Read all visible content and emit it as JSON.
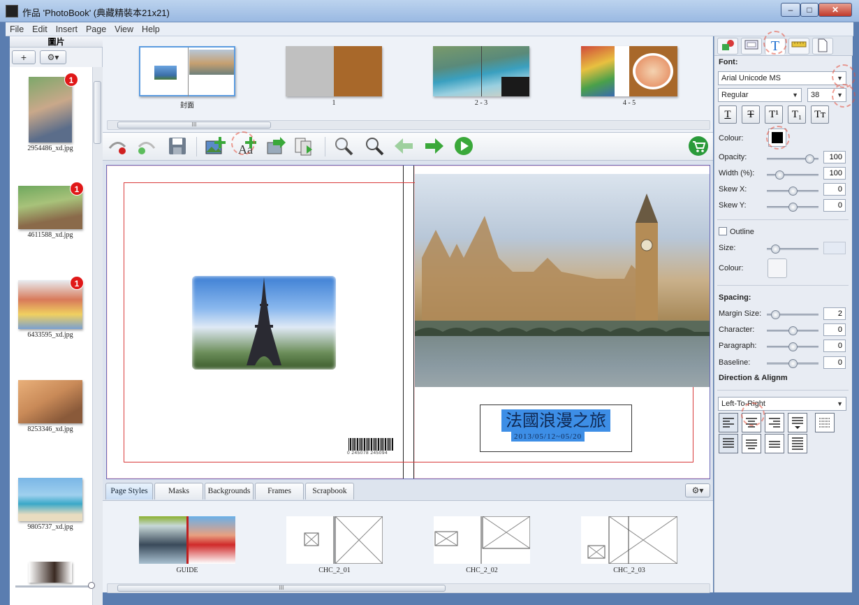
{
  "window": {
    "title": "作品 'PhotoBook' (典藏精裝本21x21)",
    "min_label": "‒",
    "max_label": "□",
    "close_label": "✕"
  },
  "menu": [
    "File",
    "Edit",
    "Insert",
    "Page",
    "View",
    "Help"
  ],
  "photos_panel": {
    "title": "圖片",
    "add_label": "+",
    "gear_label": "⚙▾",
    "items": [
      {
        "name": "2954486_xd.jpg",
        "badge": "1"
      },
      {
        "name": "4611588_xd.jpg",
        "badge": "1"
      },
      {
        "name": "6433595_xd.jpg",
        "badge": "1"
      },
      {
        "name": "8253346_xd.jpg",
        "badge": ""
      },
      {
        "name": "9805737_xd.jpg",
        "badge": ""
      }
    ]
  },
  "spreads": [
    {
      "label": "封面"
    },
    {
      "label": "1"
    },
    {
      "label": "2 - 3"
    },
    {
      "label": "4 - 5"
    }
  ],
  "scroll_grip": "III",
  "cover": {
    "title": "法國浪漫之旅",
    "date": "2013/05/12~05/20",
    "barcode": "0 245078 245094"
  },
  "tabs": [
    "Page Styles",
    "Masks",
    "Backgrounds",
    "Frames",
    "Scrapbook"
  ],
  "page_styles": [
    {
      "name": "GUIDE"
    },
    {
      "name": "CHC_2_01"
    },
    {
      "name": "CHC_2_02"
    },
    {
      "name": "CHC_2_03"
    }
  ],
  "text_panel": {
    "font_heading": "Font:",
    "font_name": "Arial Unicode MS",
    "font_style": "Regular",
    "font_size": "38",
    "format_buttons": [
      "T",
      "T",
      "T¹",
      "T₁",
      "Tт"
    ],
    "colour_label": "Colour:",
    "opacity_label": "Opacity:",
    "opacity": "100",
    "opacity_level": 0.9,
    "width_label": "Width (%):",
    "width": "100",
    "width_level": 0.2,
    "skewx_label": "Skew X:",
    "skewx": "0",
    "skewx_level": 0.5,
    "skewy_label": "Skew Y:",
    "skewy": "0",
    "skewy_level": 0.5,
    "outline_label": "Outline",
    "size_label": "Size:",
    "size_level": 0.1,
    "outline_colour_label": "Colour:",
    "spacing_heading": "Spacing:",
    "margin_label": "Margin Size:",
    "margin": "2",
    "margin_level": 0.1,
    "character_label": "Character:",
    "character": "0",
    "character_level": 0.5,
    "paragraph_label": "Paragraph:",
    "paragraph": "0",
    "paragraph_level": 0.5,
    "baseline_label": "Baseline:",
    "baseline": "0",
    "baseline_level": 0.5,
    "direction_heading": "Direction & Alignm",
    "direction": "Left-To-Right"
  },
  "colors": {
    "accent": "#1e6fd0",
    "text_highlight": "#3d8ee6",
    "canvas_bleed": "#fdd8dc",
    "badge": "#e01818"
  }
}
